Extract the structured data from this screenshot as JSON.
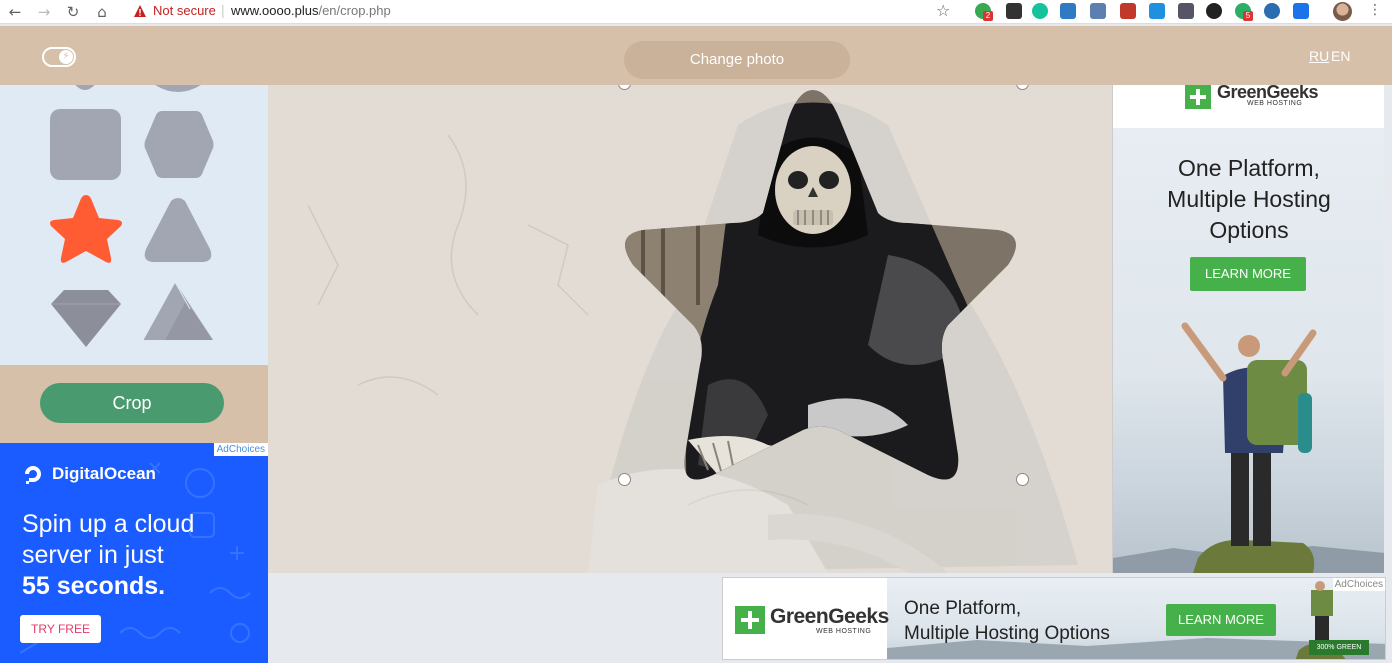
{
  "browser": {
    "security_label": "Not secure",
    "url_host": "www.oooo.plus",
    "url_path": "/en/crop.php",
    "extension_badges": [
      "2",
      "5"
    ]
  },
  "header": {
    "change_photo_label": "Change photo",
    "lang_ru": "RU",
    "lang_en": "EN"
  },
  "shapes": {
    "items": [
      "rounded-square",
      "hexagon",
      "star",
      "rounded-triangle",
      "diamond",
      "mountains"
    ],
    "selected": "star",
    "selected_color": "#ff5c33",
    "default_color": "#a2a6b3"
  },
  "crop": {
    "label": "Crop"
  },
  "ad_left": {
    "adchoices": "AdChoices",
    "brand": "DigitalOcean",
    "headline_1": "Spin up a cloud",
    "headline_2": "server in just",
    "headline_3": "55 seconds.",
    "cta": "TRY FREE"
  },
  "ad_right": {
    "brand": "GreenGeeks",
    "brand_sub": "WEB HOSTING",
    "headline_1": "One Platform,",
    "headline_2": "Multiple Hosting",
    "headline_3": "Options",
    "cta": "LEARN MORE"
  },
  "ad_bottom": {
    "brand": "GreenGeeks",
    "brand_sub": "WEB HOSTING",
    "headline_1": "One Platform,",
    "headline_2": "Multiple Hosting Options",
    "cta": "LEARN MORE",
    "adchoices": "AdChoices",
    "badge": "300% GREEN"
  },
  "colors": {
    "header_bg": "#d7c0a9",
    "crop_button": "#4a9a6f",
    "do_blue": "#1a5cff",
    "gg_green": "#46b04a"
  }
}
